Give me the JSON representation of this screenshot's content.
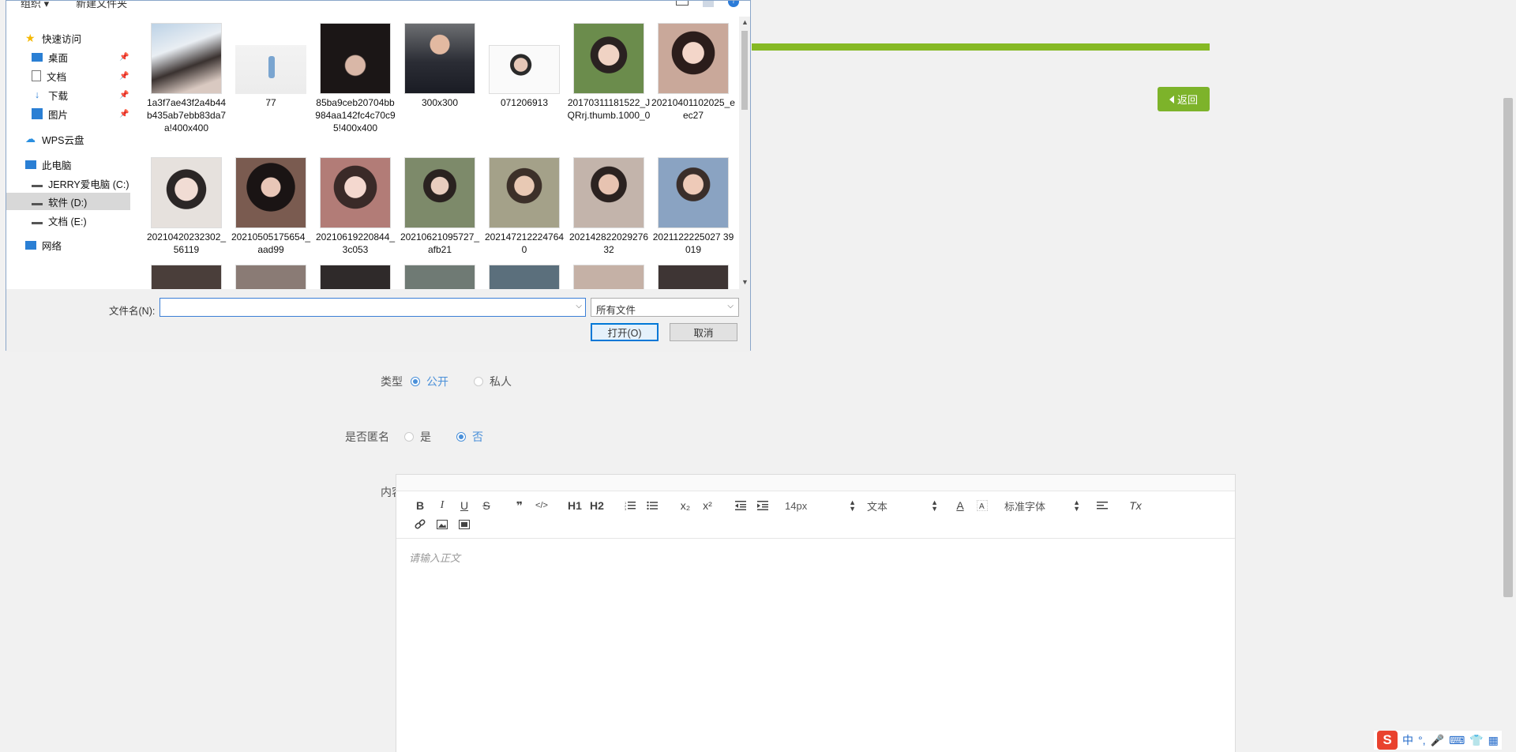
{
  "page": {
    "back_label": "返回",
    "type_label": "类型",
    "type_options": [
      {
        "label": "公开",
        "selected": true
      },
      {
        "label": "私人",
        "selected": false
      }
    ],
    "anonymous_label": "是否匿名",
    "anonymous_options": [
      {
        "label": "是",
        "selected": false
      },
      {
        "label": "否",
        "selected": true
      }
    ],
    "content_label": "内容",
    "editor": {
      "font_size": "14px",
      "block_type": "文本",
      "font_family": "标准字体",
      "placeholder": "请输入正文",
      "tool_labels": {
        "bold": "B",
        "italic": "I",
        "underline": "U",
        "strike": "S",
        "quote": "❞",
        "code": "</>",
        "h1": "H1",
        "h2": "H2",
        "sub": "x₂",
        "sup": "x²",
        "clear": "Tx",
        "color": "A"
      }
    },
    "accent_color": "#7db32a"
  },
  "dialog": {
    "toolbar": {
      "organize": "组织 ▾",
      "new_folder": "新建文件夹"
    },
    "nav": {
      "quick_access": "快速访问",
      "desktop": "桌面",
      "documents": "文档",
      "downloads": "下载",
      "pictures": "图片",
      "wps": "WPS云盘",
      "this_pc": "此电脑",
      "drive_c": "JERRY爱电脑 (C:)",
      "drive_d": "软件 (D:)",
      "drive_e": "文档 (E:)",
      "network": "网络"
    },
    "files": [
      "1a3f7ae43f2a4b44b435ab7ebb83da7a!400x400",
      "77",
      "85ba9ceb20704bb984aa142fc4c70c95!400x400",
      "300x300",
      "071206913",
      "20170311181522_JQRrj.thumb.1000_0",
      "20210401102025_eec27",
      "20210420232302_56119",
      "20210505175654_aad99",
      "20210619220844_3c053",
      "20210621095727_afb21",
      "2021472122247640",
      "20214282202927632",
      "2021122225027 39019"
    ],
    "filename_label": "文件名(N):",
    "filename_value": "",
    "filetype": "所有文件",
    "open_label": "打开(O)",
    "cancel_label": "取消"
  },
  "ime": {
    "logo": "S",
    "lang": "中",
    "punct": "°,"
  }
}
